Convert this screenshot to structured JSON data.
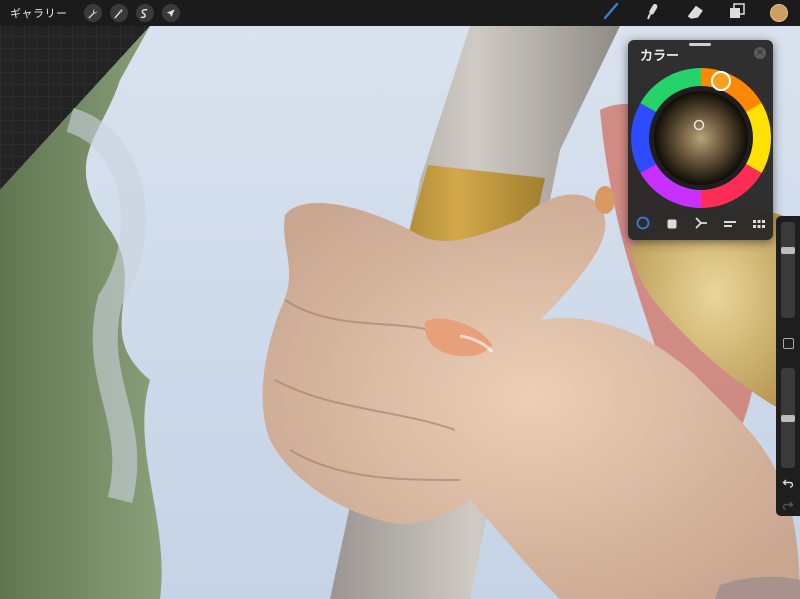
{
  "topbar": {
    "gallery_label": "ギャラリー",
    "left_tools": [
      {
        "name": "wrench-icon"
      },
      {
        "name": "magic-wand-icon"
      },
      {
        "name": "selection-icon"
      },
      {
        "name": "transform-arrow-icon"
      }
    ],
    "right_tools": [
      {
        "name": "brush-icon",
        "active": true
      },
      {
        "name": "smudge-icon"
      },
      {
        "name": "eraser-icon"
      },
      {
        "name": "layers-icon"
      }
    ],
    "current_color": "#c9a062",
    "accent": "#3a7bd5"
  },
  "color_panel": {
    "title": "カラー",
    "close_icon": "close-icon",
    "tabs": [
      {
        "name": "disc-tab-icon",
        "active": true
      },
      {
        "name": "classic-tab-icon"
      },
      {
        "name": "harmony-tab-icon"
      },
      {
        "name": "value-tab-icon"
      },
      {
        "name": "palettes-tab-icon"
      }
    ],
    "selected_color": "#f7a21b"
  },
  "sidebar": {
    "brush_size_level": 0.28,
    "opacity_level": 0.5
  }
}
